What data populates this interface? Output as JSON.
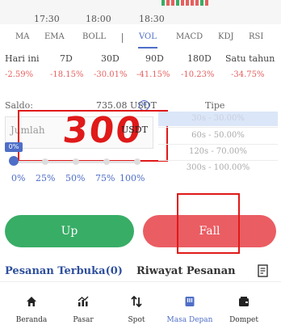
{
  "time_axis": {
    "ticks": [
      "17:30",
      "18:00",
      "18:30"
    ]
  },
  "indicators": {
    "items": [
      "MA",
      "EMA",
      "BOLL",
      "VOL",
      "MACD",
      "KDJ",
      "RSI"
    ],
    "active": "VOL"
  },
  "periods": {
    "labels": [
      "Hari ini",
      "7D",
      "30D",
      "90D",
      "180D",
      "Satu tahun"
    ],
    "changes": [
      "-2.59%",
      "-18.15%",
      "-30.01%",
      "-41.15%",
      "-10.23%",
      "-34.75%"
    ]
  },
  "balance": {
    "label": "Saldo:",
    "value": "735.08 USDT",
    "icon": "plus-circle-icon"
  },
  "amount": {
    "placeholder": "Jumlah",
    "handwritten": "300",
    "unit": "USDT"
  },
  "slider": {
    "badge": "0%",
    "value_percent": 0,
    "marks": [
      "0%",
      "25%",
      "50%",
      "75%",
      "100%"
    ]
  },
  "tipe": {
    "title": "Tipe",
    "options": [
      "30s - 30.00%",
      "60s - 50.00%",
      "120s - 70.00%",
      "300s - 100.00%"
    ],
    "selected": "30s - 30.00%"
  },
  "actions": {
    "up_label": "Up",
    "fall_label": "Fall"
  },
  "orders": {
    "open_tab": "Pesanan Terbuka(0)",
    "history_tab": "Riwayat Pesanan"
  },
  "nav": {
    "items": [
      {
        "label": "Beranda",
        "icon": "home-icon"
      },
      {
        "label": "Pasar",
        "icon": "chart-icon"
      },
      {
        "label": "Spot",
        "icon": "swap-icon"
      },
      {
        "label": "Masa Depan",
        "icon": "futures-icon"
      },
      {
        "label": "Dompet",
        "icon": "wallet-icon"
      }
    ],
    "active": "Masa Depan"
  },
  "colors": {
    "accent": "#4e6ec7",
    "up": "#38ad66",
    "fall": "#ea5d63",
    "negative": "#e4605f",
    "annotation": "#e01919"
  }
}
